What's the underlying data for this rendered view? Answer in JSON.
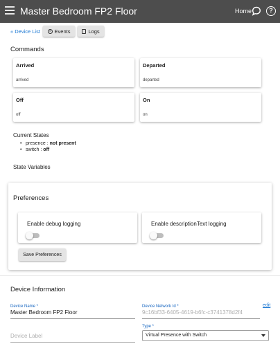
{
  "header": {
    "title": "Master Bedroom FP2 Floor",
    "home_label": "Home"
  },
  "nav": {
    "device_list_label": "« Device List",
    "events_label": "Events",
    "logs_label": "Logs"
  },
  "commands": {
    "title": "Commands",
    "items": [
      {
        "name": "Arrived",
        "value": "arrived"
      },
      {
        "name": "Departed",
        "value": "departed"
      },
      {
        "name": "Off",
        "value": "off"
      },
      {
        "name": "On",
        "value": "on"
      }
    ]
  },
  "current_states": {
    "title": "Current States",
    "items": [
      {
        "key": "presence :",
        "value": "not present"
      },
      {
        "key": "switch :",
        "value": "off"
      }
    ]
  },
  "state_variables": {
    "title": "State Variables"
  },
  "preferences": {
    "title": "Preferences",
    "items": [
      {
        "label": "Enable debug logging",
        "enabled": false
      },
      {
        "label": "Enable descriptionText logging",
        "enabled": false
      }
    ],
    "save_label": "Save Preferences"
  },
  "device_info": {
    "title": "Device Information",
    "device_name_label": "Device Name *",
    "device_name_value": "Master Bedroom FP2 Floor",
    "device_label_placeholder": "Device Label",
    "network_id_label": "Device Network Id *",
    "network_id_value": "9c16bf33-6405-4619-b6fc-c3741378d2f4",
    "edit_label": "edit",
    "type_label": "Type *",
    "type_value": "Virtual Presence with Switch"
  },
  "colors": {
    "header_bg": "#4d4d4d",
    "link": "#1976d2",
    "button_bg": "#e4e4e4"
  }
}
